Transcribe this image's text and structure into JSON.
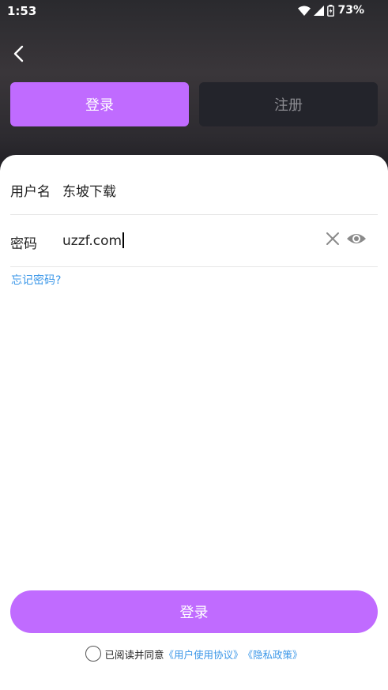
{
  "status_bar": {
    "time": "1:53",
    "battery": "73%"
  },
  "tabs": {
    "login": "登录",
    "register": "注册"
  },
  "form": {
    "username_label": "用户名",
    "username_value": "东坡下载",
    "password_label": "密码",
    "password_value": "uzzf.com"
  },
  "forgot_label": "忘记密码?",
  "submit_label": "登录",
  "agreement": {
    "text": "已阅读并同意",
    "user_agreement": "《用户使用协议》",
    "privacy_policy": "《隐私政策》"
  },
  "colors": {
    "accent": "#c06bff",
    "link": "#3b97e8",
    "tab_inactive": "#23242b"
  }
}
